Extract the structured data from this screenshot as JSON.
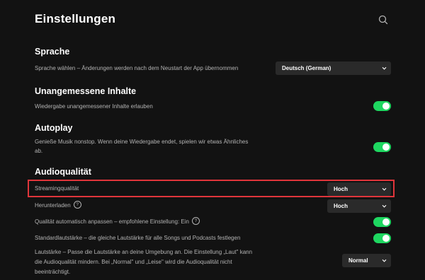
{
  "header": {
    "title": "Einstellungen",
    "search_icon": "search-icon"
  },
  "sections": {
    "language": {
      "heading": "Sprache",
      "label": "Sprache wählen – Änderungen werden nach dem Neustart der App übernommen",
      "selected": "Deutsch (German)"
    },
    "explicit": {
      "heading": "Unangemessene Inhalte",
      "label": "Wiedergabe unangemessener Inhalte erlauben",
      "enabled": true
    },
    "autoplay": {
      "heading": "Autoplay",
      "label_line1": "Genieße Musik nonstop. Wenn deine Wiedergabe endet, spielen wir etwas Ähnliches",
      "label_line2": "ab.",
      "enabled": true
    },
    "audio": {
      "heading": "Audioqualität",
      "streaming_label": "Streamingqualität",
      "streaming_value": "Hoch",
      "download_label": "Herunterladen",
      "download_help": "?",
      "download_value": "Hoch",
      "auto_adjust_label": "Qualität automatisch anpassen – empfohlene Einstellung: Ein",
      "auto_adjust_help": "?",
      "auto_adjust_enabled": true,
      "normalize_label": "Standardlautstärke – die gleiche Lautstärke für alle Songs und Podcasts festlegen",
      "normalize_enabled": true,
      "volume_label_line1": "Lautstärke – Passe die Lautstärke an deine Umgebung an. Die Einstellung „Laut\" kann",
      "volume_label_line2": "die Audioqualität mindern. Bei „Normal\" und „Leise\" wird die Audioqualität nicht",
      "volume_label_line3": "beeinträchtigt.",
      "volume_value": "Normal"
    }
  },
  "colors": {
    "background": "#121212",
    "toggle_on": "#1ed760",
    "select_bg": "#2a2a2a",
    "highlight": "#e0353b"
  }
}
